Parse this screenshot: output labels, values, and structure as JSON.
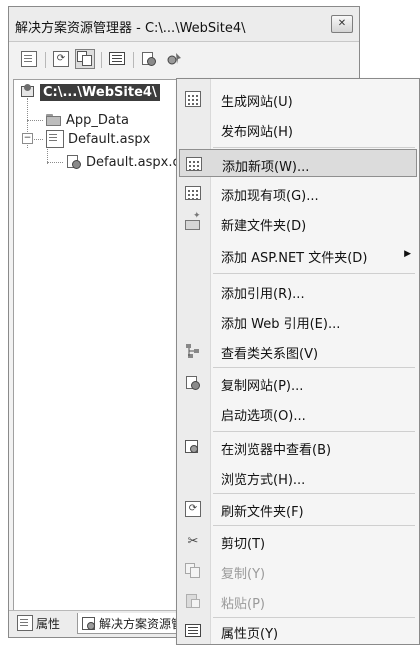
{
  "window": {
    "title": "解决方案资源管理器 - C:\\...\\WebSite4\\",
    "close_label": "✕"
  },
  "toolbar": {
    "buttons": [
      {
        "icon": "properties-icon"
      },
      {
        "icon": "refresh-icon"
      },
      {
        "icon": "nest-related-files-icon",
        "pressed": true
      },
      {
        "icon": "view-code-icon"
      },
      {
        "icon": "copy-website-icon"
      },
      {
        "icon": "asp-net-configuration-icon"
      }
    ]
  },
  "tree": {
    "root": {
      "label": "C:\\...\\WebSite4\\",
      "icon": "website-icon",
      "selected": true
    },
    "children": [
      {
        "label": "App_Data",
        "icon": "folder-icon"
      },
      {
        "label": "Default.aspx",
        "icon": "aspx-page-icon",
        "expander": "−"
      },
      {
        "label": "Default.aspx.cs",
        "icon": "code-file-icon",
        "level": 2
      }
    ]
  },
  "bottom_tabs": [
    {
      "label": "属性",
      "icon": "properties-tab-icon"
    },
    {
      "label": "解决方案资源管理器",
      "icon": "solution-explorer-tab-icon",
      "active": true
    }
  ],
  "context_menu": {
    "items": [
      {
        "label": "生成网站(U)",
        "icon": "build-icon"
      },
      {
        "label": "发布网站(H)",
        "icon": ""
      },
      {
        "label": "添加新项(W)...",
        "icon": "add-new-item-icon",
        "highlight": true
      },
      {
        "label": "添加现有项(G)...",
        "icon": "add-existing-item-icon"
      },
      {
        "label": "新建文件夹(D)",
        "icon": "new-folder-icon"
      },
      {
        "label": "添加 ASP.NET 文件夹(D)",
        "icon": "",
        "submenu": true,
        "arrow": "▶"
      },
      {
        "label": "添加引用(R)...",
        "icon": ""
      },
      {
        "label": "添加 Web 引用(E)...",
        "icon": ""
      },
      {
        "label": "查看类关系图(V)",
        "icon": "class-diagram-icon"
      },
      {
        "label": "复制网站(P)...",
        "icon": "copy-website-icon"
      },
      {
        "label": "启动选项(O)...",
        "icon": ""
      },
      {
        "label": "在浏览器中查看(B)",
        "icon": "view-in-browser-icon"
      },
      {
        "label": "浏览方式(H)...",
        "icon": ""
      },
      {
        "label": "刷新文件夹(F)",
        "icon": "refresh-folder-icon"
      },
      {
        "label": "剪切(T)",
        "icon": "cut-icon",
        "glyph": "✂"
      },
      {
        "label": "复制(Y)",
        "icon": "copy-icon",
        "disabled": true
      },
      {
        "label": "粘贴(P)",
        "icon": "paste-icon",
        "disabled": true
      },
      {
        "label": "属性页(Y)",
        "icon": "property-pages-icon"
      }
    ]
  }
}
